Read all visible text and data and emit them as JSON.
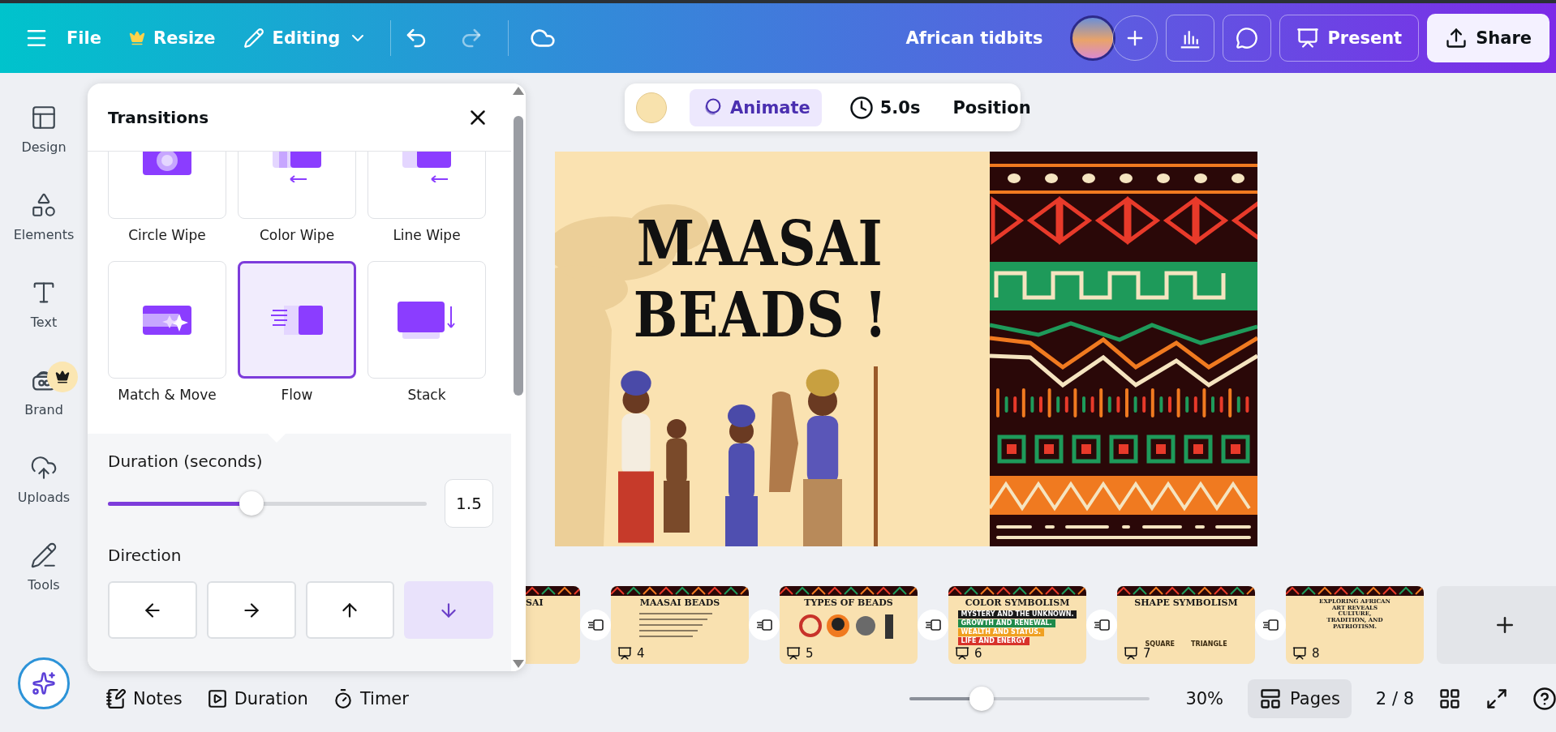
{
  "topbar": {
    "file": "File",
    "resize": "Resize",
    "mode": "Editing",
    "title": "African tidbits",
    "present": "Present",
    "share": "Share"
  },
  "sidebar": {
    "items": [
      {
        "label": "Design",
        "kind": "design",
        "premium": false
      },
      {
        "label": "Elements",
        "kind": "elements",
        "premium": false
      },
      {
        "label": "Text",
        "kind": "text",
        "premium": false
      },
      {
        "label": "Brand",
        "kind": "brand",
        "premium": true
      },
      {
        "label": "Uploads",
        "kind": "uploads",
        "premium": false
      },
      {
        "label": "Tools",
        "kind": "tools",
        "premium": false
      }
    ]
  },
  "transitions": {
    "title": "Transitions",
    "tiles": [
      {
        "label": "Circle Wipe",
        "kind": "circle",
        "selected": false
      },
      {
        "label": "Color Wipe",
        "kind": "color",
        "selected": false
      },
      {
        "label": "Line Wipe",
        "kind": "line",
        "selected": false
      },
      {
        "label": "Match & Move",
        "kind": "match",
        "selected": false
      },
      {
        "label": "Flow",
        "kind": "flow",
        "selected": true
      },
      {
        "label": "Stack",
        "kind": "stack",
        "selected": false
      }
    ],
    "duration": {
      "label": "Duration (seconds)",
      "level": 0.45,
      "value": "1.5"
    },
    "direction": {
      "label": "Direction",
      "options": [
        {
          "kind": "left",
          "selected": false
        },
        {
          "kind": "right",
          "selected": false
        },
        {
          "kind": "up",
          "selected": false
        },
        {
          "kind": "down",
          "selected": true
        }
      ]
    }
  },
  "toolbar": {
    "animate": "Animate",
    "time": "5.0s",
    "position": "Position"
  },
  "slide": {
    "title": [
      "MAASAI",
      "BEADS !"
    ]
  },
  "pages": [
    {
      "kind": "partial",
      "title": "SAI"
    },
    {
      "kind": "text",
      "title": "MAASAI BEADS",
      "page": "4"
    },
    {
      "kind": "types",
      "title": "TYPES OF BEADS",
      "page": "5"
    },
    {
      "kind": "colors",
      "title": "COLOR SYMBOLISM",
      "page": "6",
      "bars": [
        {
          "label": "MYSTERY AND THE UNKNOWN.",
          "color": "#1a1a1a"
        },
        {
          "label": "GROWTH AND RENEWAL.",
          "color": "#1e8a4a"
        },
        {
          "label": "WEALTH AND STATUS.",
          "color": "#f0a020"
        },
        {
          "label": "LIFE AND ENERGY",
          "color": "#d8322a"
        }
      ]
    },
    {
      "kind": "shapes",
      "title": "SHAPE SYMBOLISM",
      "page": "7",
      "labels": [
        "SQUARE",
        "TRIANGLE"
      ]
    },
    {
      "kind": "art",
      "title": "EXPLORING AFRICAN ART REVEALS CULTURE, TRADITION, AND PATRIOTISM.",
      "page": "8"
    }
  ],
  "bottombar": {
    "notes": "Notes",
    "duration": "Duration",
    "timer": "Timer",
    "zoom": {
      "level": 0.3,
      "value": "30%"
    },
    "pages": "Pages",
    "count": "2 / 8"
  }
}
